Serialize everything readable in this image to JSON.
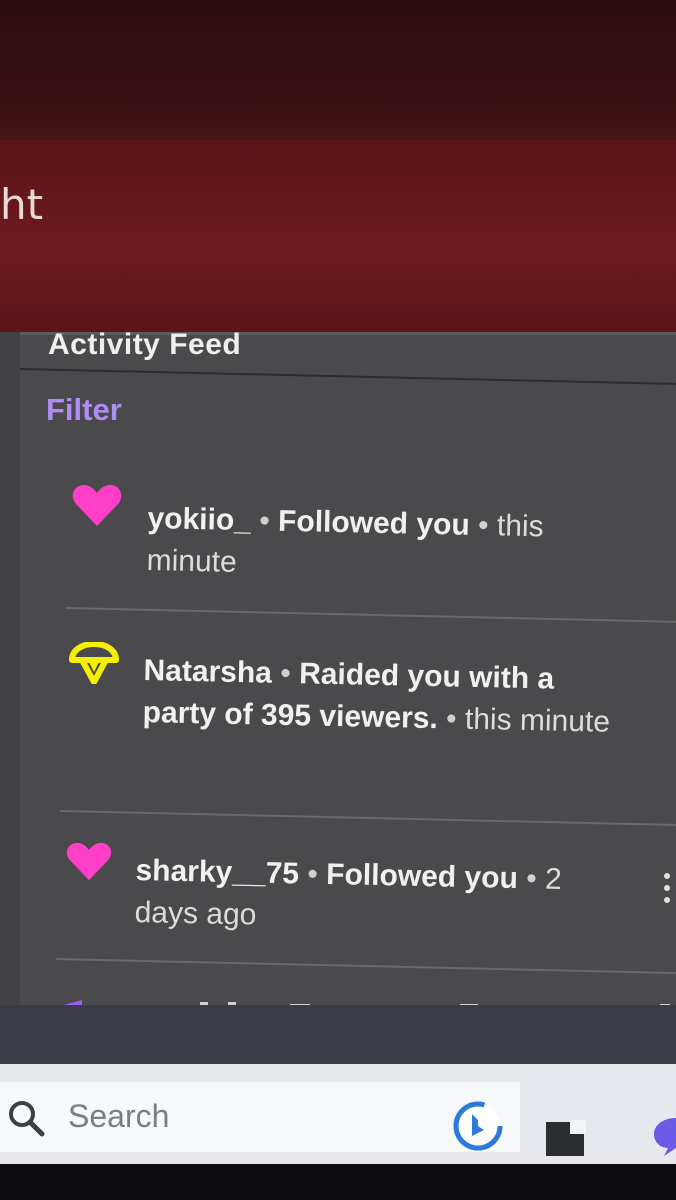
{
  "background": {
    "partial_text": "ht"
  },
  "feed": {
    "title": "Activity Feed",
    "filter_label": "Filter",
    "items": [
      {
        "user": "yokiio_",
        "action": "Followed you",
        "time": "this minute",
        "icon": "heart-icon",
        "icon_color": "#ff3fc8"
      },
      {
        "user": "Natarsha",
        "action": "Raided you with a party of 395 viewers.",
        "time": "this minute",
        "icon": "raid-icon",
        "icon_color": "#f5f000"
      },
      {
        "user": "sharky__75",
        "action": "Followed you",
        "time": "2 days ago",
        "icon": "heart-icon",
        "icon_color": "#ff3fc8"
      }
    ],
    "separator": "•"
  },
  "taskbar": {
    "search_placeholder": "Search"
  }
}
